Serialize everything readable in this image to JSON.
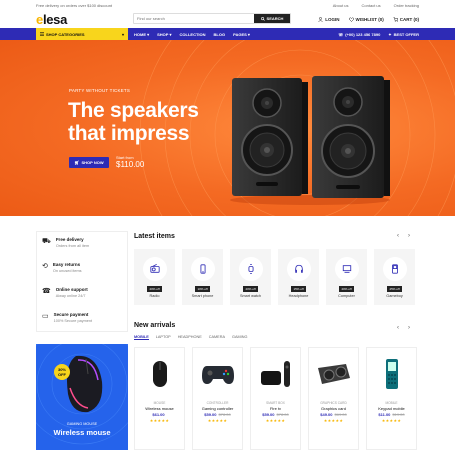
{
  "topbar": {
    "promo": "Free delivery on orders over $100 discount",
    "links": [
      "About us",
      "Contact us",
      "Order tracking"
    ]
  },
  "header": {
    "logo": "elesa",
    "search_placeholder": "Find our search",
    "search_button": "SEARCH",
    "login": "LOGIN",
    "wishlist": "WISHLIST (0)",
    "cart": "CART (0)"
  },
  "nav": {
    "categories": "SHOP CATEGORIES",
    "menu": [
      "HOME",
      "SHOP",
      "COLLECTION",
      "BLOG",
      "PAGES"
    ],
    "phone": "(+00) 123 456 7890",
    "best_offer": "BEST OFFER"
  },
  "hero": {
    "tag": "PARTY WITHOUT TICKETS",
    "title_line1": "The speakers",
    "title_line2": "that impress",
    "shop_button": "SHOP NOW",
    "from_label": "Start from",
    "price": "$110.00"
  },
  "features": [
    {
      "title": "Free delivery",
      "sub": "Orders from all item",
      "icon": "truck-icon"
    },
    {
      "title": "Easy returns",
      "sub": "On unused items",
      "icon": "return-icon"
    },
    {
      "title": "Online support",
      "sub": "Alway online 24/7",
      "icon": "support-icon"
    },
    {
      "title": "Secure payment",
      "sub": "100% Secure payment",
      "icon": "card-icon"
    }
  ],
  "latest": {
    "title": "Latest items",
    "items": [
      {
        "name": "Radio",
        "badge": "20% off",
        "icon": "radio-icon"
      },
      {
        "name": "Smart phone",
        "badge": "10% off",
        "icon": "smartphone-icon"
      },
      {
        "name": "Smart watch",
        "badge": "20% off",
        "icon": "watch-icon"
      },
      {
        "name": "Headphone",
        "badge": "15% off",
        "icon": "headphone-icon"
      },
      {
        "name": "Computer",
        "badge": "20% off",
        "icon": "computer-icon"
      },
      {
        "name": "Gameboy",
        "badge": "25% off",
        "icon": "gameboy-icon"
      }
    ]
  },
  "arrivals": {
    "title": "New arrivals",
    "tabs": [
      "MOBILE",
      "LAPTOP",
      "HEADPHONE",
      "CAMERA",
      "GAMING"
    ],
    "products": [
      {
        "cat": "MOUSE",
        "name": "Wireless mouse",
        "price": "$61.00",
        "old": ""
      },
      {
        "cat": "CONTROLLER",
        "name": "Gaming controller",
        "price": "$59.00",
        "old": "$78.00"
      },
      {
        "cat": "SMART BOX",
        "name": "Fire tv",
        "price": "$59.00",
        "old": "$78.00"
      },
      {
        "cat": "GRAPHICS CARD",
        "name": "Graphics card",
        "price": "$49.00",
        "old": "$69.00"
      },
      {
        "cat": "MOBILE",
        "name": "Keypad mobile",
        "price": "$11.00",
        "old": "$19.00"
      }
    ]
  },
  "promo": {
    "off": "30% OFF",
    "tag": "GAMING MOUSE",
    "title": "Wireless mouse"
  },
  "colors": {
    "accent": "#2e2bb5",
    "yellow": "#f8d51c",
    "orange": "#f46a23"
  }
}
